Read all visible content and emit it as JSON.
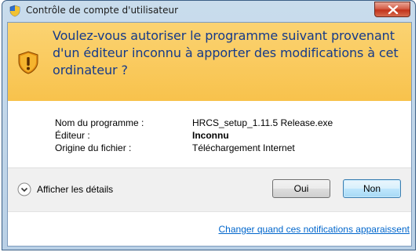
{
  "window": {
    "title": "Contrôle de compte d'utilisateur",
    "close_icon": "close-icon",
    "title_icon": "uac-shield-icon"
  },
  "banner": {
    "icon": "warning-shield-icon",
    "message": "Voulez-vous autoriser le programme suivant provenant d'un éditeur inconnu à apporter des modifications à cet ordinateur ?",
    "background": "#f8c24c",
    "text_color": "#153a8a"
  },
  "details": {
    "rows": [
      {
        "label": "Nom du programme :",
        "value": "HRCS_setup_1.11.5 Release.exe"
      },
      {
        "label": "Éditeur :",
        "value": "Inconnu"
      },
      {
        "label": "Origine du fichier :",
        "value": "Téléchargement Internet"
      }
    ]
  },
  "actions": {
    "show_details_label": "Afficher les détails",
    "yes_label": "Oui",
    "no_label": "Non"
  },
  "footer": {
    "link_text": "Changer quand ces notifications apparaissent",
    "link_color": "#0066cc"
  }
}
